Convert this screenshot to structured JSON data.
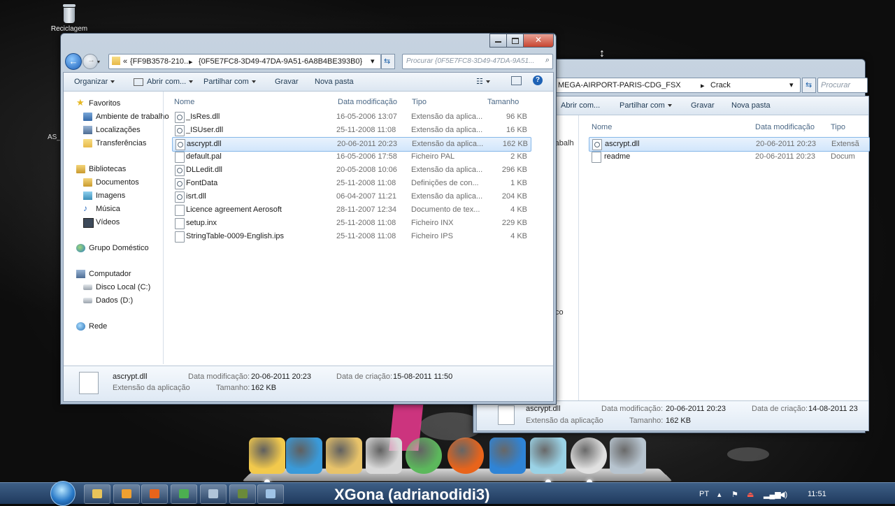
{
  "desktop": {
    "recycle_label": "Reciclagem",
    "stray_label": "AS_"
  },
  "back_window": {
    "path": [
      "MEGA-AIRPORT-PARIS-CDG_FSX",
      "Crack"
    ],
    "search_placeholder": "Procurar",
    "toolbar": [
      "Abrir com...",
      "Partilhar com",
      "Gravar",
      "Nova pasta"
    ],
    "columns": [
      "Nome",
      "Data modificação",
      "Tipo"
    ],
    "files": [
      {
        "name": "ascrypt.dll",
        "date": "20-06-2011 20:23",
        "type": "Extensã"
      },
      {
        "name": "readme",
        "date": "20-06-2011 20:23",
        "type": "Docum"
      }
    ],
    "side_fragments": [
      "rabalh",
      "co"
    ],
    "details": {
      "name": "ascrypt.dll",
      "type": "Extensão da aplicação",
      "modified_label": "Data modificação:",
      "modified": "20-06-2011 20:23",
      "size_label": "Tamanho:",
      "size": "162 KB",
      "created_label": "Data de criação:",
      "created": "14-08-2011 23"
    }
  },
  "front_window": {
    "breadcrumb_prefix": "«",
    "path": [
      "{FF9B3578-210...",
      "{0F5E7FC8-3D49-47DA-9A51-6A8B4BE393B0}"
    ],
    "search_placeholder": "Procurar {0F5E7FC8-3D49-47DA-9A51...",
    "toolbar": [
      "Organizar",
      "Abrir com...",
      "Partilhar com",
      "Gravar",
      "Nova pasta"
    ],
    "nav": [
      {
        "label": "Favoritos",
        "icon": "star-icon",
        "indent": 0
      },
      {
        "label": "Ambiente de trabalho",
        "icon": "desktop-icon",
        "indent": 1
      },
      {
        "label": "Localizações",
        "icon": "places-icon",
        "indent": 1
      },
      {
        "label": "Transferências",
        "icon": "downloads-icon",
        "indent": 1
      },
      {
        "label": "Bibliotecas",
        "icon": "libraries-icon",
        "indent": 0
      },
      {
        "label": "Documentos",
        "icon": "documents-icon",
        "indent": 1
      },
      {
        "label": "Imagens",
        "icon": "pictures-icon",
        "indent": 1
      },
      {
        "label": "Música",
        "icon": "music-icon",
        "indent": 1
      },
      {
        "label": "Vídeos",
        "icon": "videos-icon",
        "indent": 1
      },
      {
        "label": "Grupo Doméstico",
        "icon": "homegroup-icon",
        "indent": 0
      },
      {
        "label": "Computador",
        "icon": "computer-icon",
        "indent": 0
      },
      {
        "label": "Disco Local (C:)",
        "icon": "drive-icon",
        "indent": 1
      },
      {
        "label": "Dados (D:)",
        "icon": "drive-icon",
        "indent": 1
      },
      {
        "label": "Rede",
        "icon": "network-icon",
        "indent": 0
      }
    ],
    "columns": [
      "Nome",
      "Data modificação",
      "Tipo",
      "Tamanho"
    ],
    "files": [
      {
        "name": "_IsRes.dll",
        "date": "16-05-2006 13:07",
        "type": "Extensão da aplica...",
        "size": "96 KB",
        "icon": "gear"
      },
      {
        "name": "_ISUser.dll",
        "date": "25-11-2008 11:08",
        "type": "Extensão da aplica...",
        "size": "16 KB",
        "icon": "gear"
      },
      {
        "name": "ascrypt.dll",
        "date": "20-06-2011 20:23",
        "type": "Extensão da aplica...",
        "size": "162 KB",
        "icon": "gear",
        "selected": true
      },
      {
        "name": "default.pal",
        "date": "16-05-2006 17:58",
        "type": "Ficheiro PAL",
        "size": "2 KB",
        "icon": "file"
      },
      {
        "name": "DLLedit.dll",
        "date": "20-05-2008 10:06",
        "type": "Extensão da aplica...",
        "size": "296 KB",
        "icon": "gear"
      },
      {
        "name": "FontData",
        "date": "25-11-2008 11:08",
        "type": "Definições de con...",
        "size": "1 KB",
        "icon": "gear"
      },
      {
        "name": "isrt.dll",
        "date": "06-04-2007 11:21",
        "type": "Extensão da aplica...",
        "size": "204 KB",
        "icon": "gear"
      },
      {
        "name": "Licence agreement Aerosoft",
        "date": "28-11-2007 12:34",
        "type": "Documento de tex...",
        "size": "4 KB",
        "icon": "file"
      },
      {
        "name": "setup.inx",
        "date": "25-11-2008 11:08",
        "type": "Ficheiro INX",
        "size": "229 KB",
        "icon": "file"
      },
      {
        "name": "StringTable-0009-English.ips",
        "date": "25-11-2008 11:08",
        "type": "Ficheiro IPS",
        "size": "4 KB",
        "icon": "file"
      }
    ],
    "details": {
      "name": "ascrypt.dll",
      "type": "Extensão da aplicação",
      "modified_label": "Data modificação:",
      "modified": "20-06-2011 20:23",
      "size_label": "Tamanho:",
      "size": "162 KB",
      "created_label": "Data de criação:",
      "created": "15-08-2011 11:50"
    }
  },
  "dock": {
    "apps": [
      "folder-icon",
      "media-player-icon",
      "library-icon",
      "documents-icon",
      "messenger-icon",
      "firefox-icon",
      "flight-simulator-icon",
      "notepad-icon",
      "chrome-icon",
      "recycle-bin-icon"
    ],
    "colors": [
      "#f2c94c",
      "#3a9ad9",
      "#e8c36a",
      "#d9d9d9",
      "#5cb85c",
      "#e8641b",
      "#2f84d6",
      "#9ad2e6",
      "#e0e0e0",
      "#b7c4cf"
    ]
  },
  "taskbar": {
    "overlay_title": "XGona (adrianodidi3)",
    "language": "PT",
    "time": "11:51",
    "buttons": [
      "explorer-icon",
      "media-icon",
      "firefox-icon",
      "chrome-icon",
      "notepad-icon",
      "fsx-icon",
      "usb-icon"
    ]
  }
}
